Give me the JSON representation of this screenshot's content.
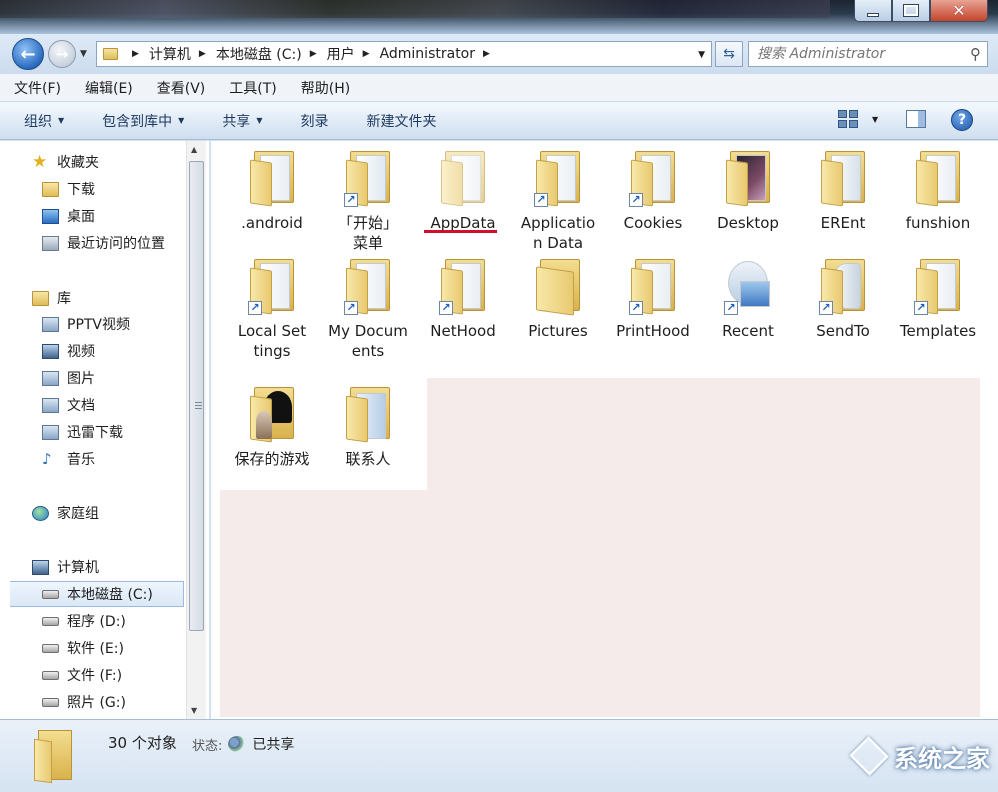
{
  "window": {
    "minimize_label": "–",
    "maximize_label": "□",
    "close_label": "✕"
  },
  "address": {
    "crumbs": [
      "计算机",
      "本地磁盘 (C:)",
      "用户",
      "Administrator"
    ],
    "search_placeholder": "搜索 Administrator"
  },
  "menu": [
    "文件(F)",
    "编辑(E)",
    "查看(V)",
    "工具(T)",
    "帮助(H)"
  ],
  "commands": {
    "organize": "组织",
    "include_in_library": "包含到库中",
    "share": "共享",
    "burn": "刻录",
    "new_folder": "新建文件夹"
  },
  "sidebar": {
    "favorites": "收藏夹",
    "downloads": "下载",
    "desktop": "桌面",
    "recent_places": "最近访问的位置",
    "libraries": "库",
    "pptv": "PPTV视频",
    "videos": "视频",
    "pictures": "图片",
    "documents": "文档",
    "xunlei": "迅雷下载",
    "music": "音乐",
    "homegroup": "家庭组",
    "computer": "计算机",
    "drive_c": "本地磁盘 (C:)",
    "drive_d": "程序 (D:)",
    "drive_e": "软件 (E:)",
    "drive_f": "文件 (F:)",
    "drive_g": "照片 (G:)"
  },
  "items": {
    "android": ".android",
    "start_menu": "「开始」菜单",
    "appdata": "AppData",
    "application_data": "Application Data",
    "cookies": "Cookies",
    "desktop": "Desktop",
    "erent": "EREnt",
    "funshion": "funshion",
    "local_settings": "Local Settings",
    "my_documents": "My Documents",
    "nethood": "NetHood",
    "pictures": "Pictures",
    "printhood": "PrintHood",
    "recent": "Recent",
    "sendto": "SendTo",
    "templates": "Templates",
    "saved_games": "保存的游戏",
    "contacts": "联系人"
  },
  "status": {
    "count": "30 个对象",
    "state_label": "状态:",
    "state_value": "已共享"
  },
  "watermark": "系统之家",
  "colors": {
    "highlight_underline": "#d0102a",
    "selection_fill": "#f5ebeb"
  }
}
